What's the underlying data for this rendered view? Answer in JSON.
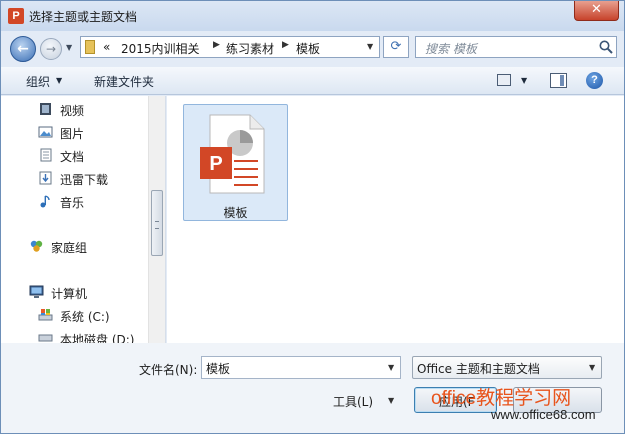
{
  "window": {
    "title": "选择主题或主题文档",
    "app_icon_letter": "P",
    "close_glyph": "✕"
  },
  "address": {
    "overflow": "«",
    "segments": [
      "2015内训相关",
      "练习素材",
      "模板"
    ],
    "search_placeholder": "搜索 模板"
  },
  "toolbar": {
    "organize_label": "组织",
    "new_folder_label": "新建文件夹",
    "help_glyph": "?"
  },
  "navpane": {
    "items": [
      {
        "label": "视频",
        "icon": "video-icon"
      },
      {
        "label": "图片",
        "icon": "pictures-icon"
      },
      {
        "label": "文档",
        "icon": "documents-icon"
      },
      {
        "label": "迅雷下载",
        "icon": "download-folder-icon"
      },
      {
        "label": "音乐",
        "icon": "music-icon"
      },
      {
        "label": "家庭组",
        "icon": "homegroup-icon"
      },
      {
        "label": "计算机",
        "icon": "computer-icon"
      },
      {
        "label": "系统 (C:)",
        "icon": "drive-icon"
      },
      {
        "label": "本地磁盘 (D:)",
        "icon": "drive-icon"
      }
    ]
  },
  "files": [
    {
      "name": "模板",
      "icon": "powerpoint-file-icon"
    }
  ],
  "bottom": {
    "filename_label": "文件名(N):",
    "filename_value": "模板",
    "filetype_value": "Office 主题和主题文档",
    "tools_label": "工具(L)",
    "apply_label": "应用(F"
  },
  "watermark": {
    "line1": "office教程学习网",
    "line2": "www.office68.com"
  },
  "colors": {
    "accent": "#3c7fb1",
    "ppt_orange": "#d24726",
    "watermark": "#e8541c"
  }
}
